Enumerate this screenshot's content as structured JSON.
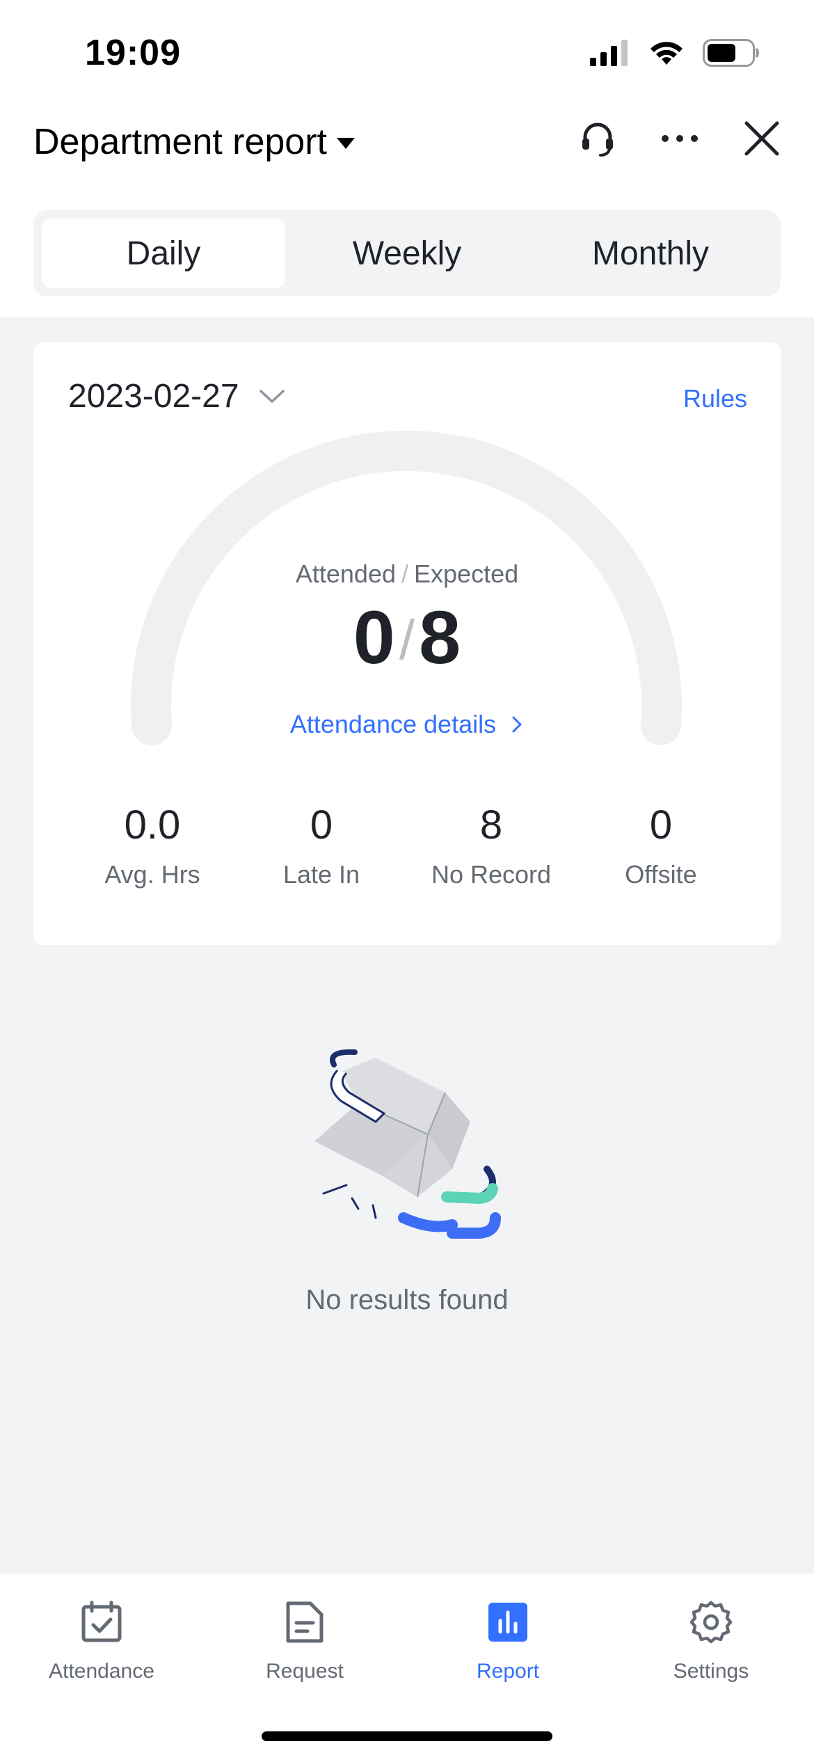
{
  "status_bar": {
    "time": "19:09"
  },
  "header": {
    "title": "Department report",
    "icons": [
      "headset-icon",
      "more-icon",
      "close-icon"
    ]
  },
  "tabs": [
    {
      "label": "Daily",
      "active": true
    },
    {
      "label": "Weekly",
      "active": false
    },
    {
      "label": "Monthly",
      "active": false
    }
  ],
  "card": {
    "date": "2023-02-27",
    "rules_label": "Rules",
    "gauge": {
      "attended_label": "Attended",
      "expected_label": "Expected",
      "attended": "0",
      "expected": "8",
      "details_label": "Attendance details"
    },
    "stats": [
      {
        "value": "0.0",
        "label": "Avg. Hrs"
      },
      {
        "value": "0",
        "label": "Late In"
      },
      {
        "value": "8",
        "label": "No Record"
      },
      {
        "value": "0",
        "label": "Offsite"
      }
    ]
  },
  "empty_state": {
    "text": "No results found"
  },
  "bottom_nav": [
    {
      "label": "Attendance",
      "icon": "calendar-check-icon",
      "active": false
    },
    {
      "label": "Request",
      "icon": "document-icon",
      "active": false
    },
    {
      "label": "Report",
      "icon": "bar-chart-icon",
      "active": true
    },
    {
      "label": "Settings",
      "icon": "gear-icon",
      "active": false
    }
  ],
  "colors": {
    "accent": "#3370ff",
    "text_primary": "#1f2329",
    "text_secondary": "#646a73",
    "background": "#f2f3f5"
  }
}
